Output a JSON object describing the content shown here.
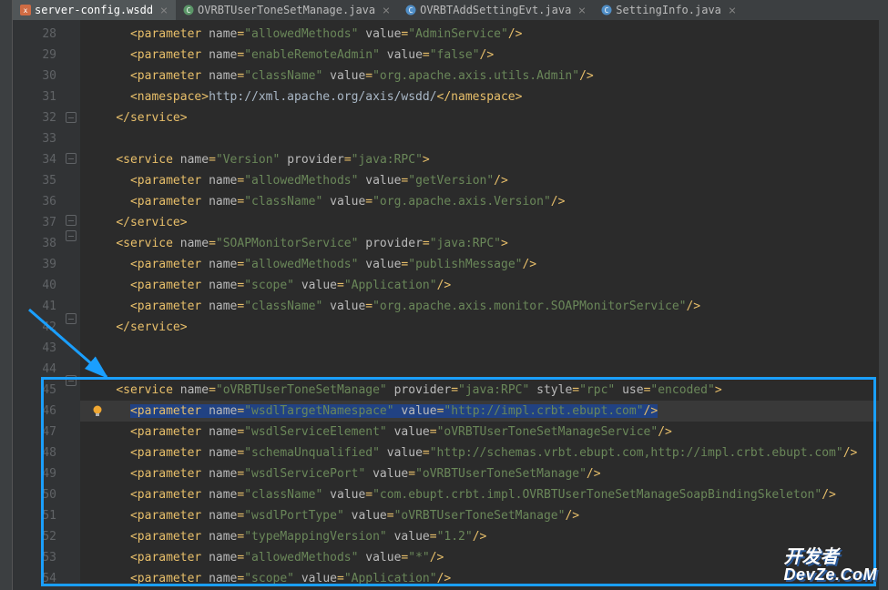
{
  "tabs": [
    {
      "label": "server-config.wsdd",
      "active": true,
      "iconColor": "#d06c44"
    },
    {
      "label": "OVRBTUserToneSetManage.java",
      "active": false,
      "iconColor": "#5b9668"
    },
    {
      "label": "OVRBTAddSettingEvt.java",
      "active": false,
      "iconColor": "#508ec6"
    },
    {
      "label": "SettingInfo.java",
      "active": false,
      "iconColor": "#508ec6"
    }
  ],
  "lines": {
    "28": {
      "type": "param",
      "name": "allowedMethods",
      "value": "AdminService",
      "indent": 3
    },
    "29": {
      "type": "param",
      "name": "enableRemoteAdmin",
      "value": "false",
      "indent": 3
    },
    "30": {
      "type": "param",
      "name": "className",
      "value": "org.apache.axis.utils.Admin",
      "indent": 3
    },
    "31": {
      "type": "namespace",
      "content": "http://xml.apache.org/axis/wsdd/",
      "indent": 3
    },
    "32": {
      "type": "close",
      "tag": "service",
      "indent": 2
    },
    "33": {
      "type": "empty"
    },
    "34": {
      "type": "service",
      "name": "Version",
      "provider": "java:RPC",
      "indent": 2
    },
    "35": {
      "type": "param",
      "name": "allowedMethods",
      "value": "getVersion",
      "indent": 3
    },
    "36": {
      "type": "param",
      "name": "className",
      "value": "org.apache.axis.Version",
      "indent": 3
    },
    "37": {
      "type": "close",
      "tag": "service",
      "indent": 2
    },
    "38": {
      "type": "service",
      "name": "SOAPMonitorService",
      "provider": "java:RPC",
      "indent": 2
    },
    "39": {
      "type": "param",
      "name": "allowedMethods",
      "value": "publishMessage",
      "indent": 3
    },
    "40": {
      "type": "param",
      "name": "scope",
      "value": "Application",
      "indent": 3
    },
    "41": {
      "type": "param",
      "name": "className",
      "value": "org.apache.axis.monitor.SOAPMonitorService",
      "indent": 3
    },
    "42": {
      "type": "close",
      "tag": "service",
      "indent": 2
    },
    "43": {
      "type": "empty"
    },
    "44": {
      "type": "empty"
    },
    "45": {
      "type": "service-full",
      "name": "oVRBTUserToneSetManage",
      "provider": "java:RPC",
      "style": "rpc",
      "use": "encoded",
      "indent": 2
    },
    "46": {
      "type": "param",
      "name": "wsdlTargetNamespace",
      "value": "http://impl.crbt.ebupt.com",
      "indent": 3,
      "current": true
    },
    "47": {
      "type": "param",
      "name": "wsdlServiceElement",
      "value": "oVRBTUserToneSetManageService",
      "indent": 3
    },
    "48": {
      "type": "param",
      "name": "schemaUnqualified",
      "value": "http://schemas.vrbt.ebupt.com,http://impl.crbt.ebupt.com",
      "indent": 3
    },
    "49": {
      "type": "param",
      "name": "wsdlServicePort",
      "value": "oVRBTUserToneSetManage",
      "indent": 3
    },
    "50": {
      "type": "param",
      "name": "className",
      "value": "com.ebupt.crbt.impl.OVRBTUserToneSetManageSoapBindingSkeleton",
      "indent": 3
    },
    "51": {
      "type": "param",
      "name": "wsdlPortType",
      "value": "oVRBTUserToneSetManage",
      "indent": 3
    },
    "52": {
      "type": "param",
      "name": "typeMappingVersion",
      "value": "1.2",
      "indent": 3
    },
    "53": {
      "type": "param",
      "name": "allowedMethods",
      "value": "*",
      "indent": 3
    },
    "54": {
      "type": "param",
      "name": "scope",
      "value": "Application",
      "indent": 3
    }
  },
  "lineNumbers": [
    "28",
    "29",
    "30",
    "31",
    "32",
    "33",
    "34",
    "35",
    "36",
    "37",
    "38",
    "39",
    "40",
    "41",
    "42",
    "43",
    "44",
    "45",
    "46",
    "47",
    "48",
    "49",
    "50",
    "51",
    "52",
    "53",
    "54"
  ],
  "watermark": {
    "line1": "开发者",
    "line2": "DevZe.CoM"
  }
}
